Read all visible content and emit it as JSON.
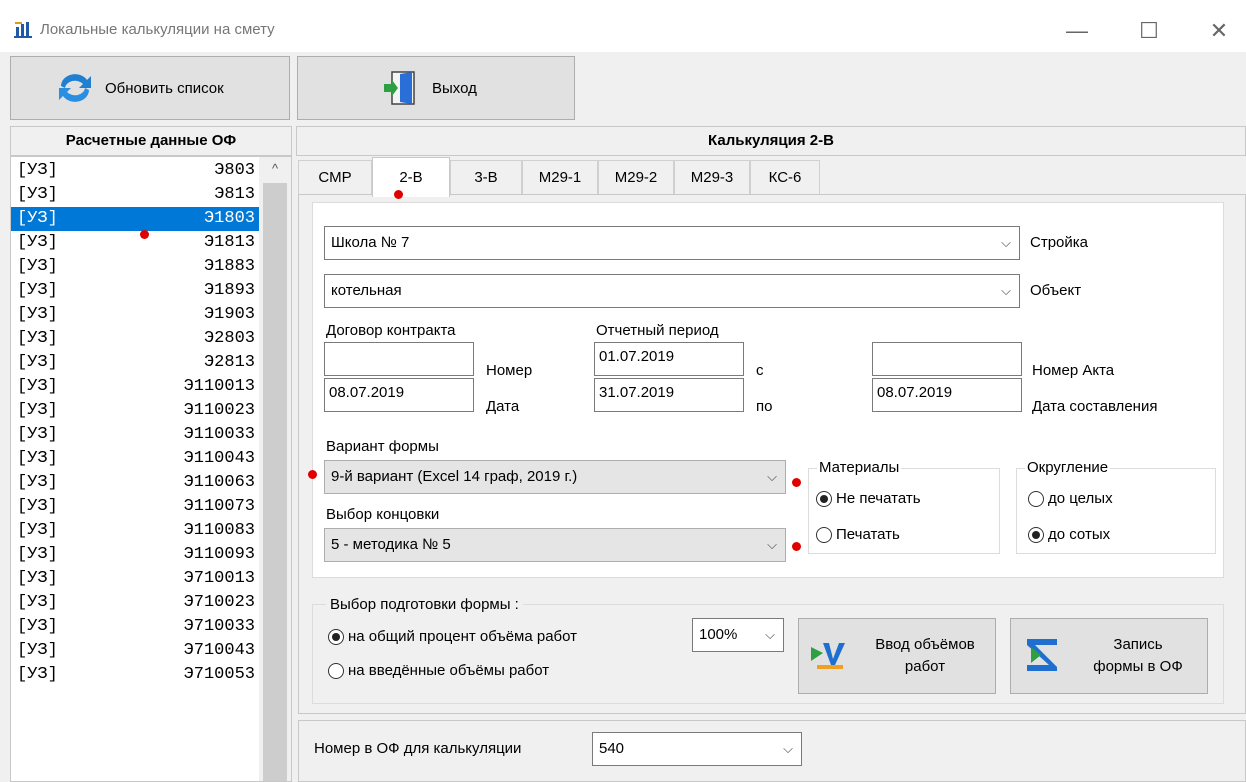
{
  "window": {
    "title": "Локальные калькуляции на смету",
    "min_glyph": "—",
    "max_glyph": "☐",
    "close_glyph": "✕"
  },
  "toolbar": {
    "refresh_label": "Обновить список",
    "exit_label": "Выход"
  },
  "left_panel": {
    "header": "Расчетные данные ОФ",
    "rows": [
      {
        "left": "[УЗ]",
        "right": "Э803"
      },
      {
        "left": "[УЗ]",
        "right": "Э813"
      },
      {
        "left": "[УЗ]",
        "right": "Э1803"
      },
      {
        "left": "[УЗ]",
        "right": "Э1813"
      },
      {
        "left": "[УЗ]",
        "right": "Э1883"
      },
      {
        "left": "[УЗ]",
        "right": "Э1893"
      },
      {
        "left": "[УЗ]",
        "right": "Э1903"
      },
      {
        "left": "[УЗ]",
        "right": "Э2803"
      },
      {
        "left": "[УЗ]",
        "right": "Э2813"
      },
      {
        "left": "[УЗ]",
        "right": "Э110013"
      },
      {
        "left": "[УЗ]",
        "right": "Э110023"
      },
      {
        "left": "[УЗ]",
        "right": "Э110033"
      },
      {
        "left": "[УЗ]",
        "right": "Э110043"
      },
      {
        "left": "[УЗ]",
        "right": "Э110063"
      },
      {
        "left": "[УЗ]",
        "right": "Э110073"
      },
      {
        "left": "[УЗ]",
        "right": "Э110083"
      },
      {
        "left": "[УЗ]",
        "right": "Э110093"
      },
      {
        "left": "[УЗ]",
        "right": "Э710013"
      },
      {
        "left": "[УЗ]",
        "right": "Э710023"
      },
      {
        "left": "[УЗ]",
        "right": "Э710033"
      },
      {
        "left": "[УЗ]",
        "right": "Э710043"
      },
      {
        "left": "[УЗ]",
        "right": "Э710053"
      }
    ],
    "selected_index": 2,
    "scroll_up_glyph": "^"
  },
  "right_panel": {
    "header": "Калькуляция 2-В",
    "tabs": [
      {
        "label": "СМР"
      },
      {
        "label": "2-В"
      },
      {
        "label": "3-В"
      },
      {
        "label": "М29-1"
      },
      {
        "label": "М29-2"
      },
      {
        "label": "М29-3"
      },
      {
        "label": "КС-6"
      }
    ],
    "active_tab": 1
  },
  "form": {
    "construction": {
      "value": "Школа № 7",
      "label": "Стройка"
    },
    "object": {
      "value": "котельная",
      "label": "Объект"
    },
    "contract": {
      "title": "Договор контракта",
      "number_value": "",
      "number_label": "Номер",
      "date_value": "08.07.2019",
      "date_label": "Дата"
    },
    "period": {
      "title": "Отчетный период",
      "from_value": "01.07.2019",
      "from_label": "с",
      "to_value": "31.07.2019",
      "to_label": "по"
    },
    "act": {
      "number_value": "",
      "number_label": "Номер Акта",
      "date_value": "08.07.2019",
      "date_label": "Дата составления"
    },
    "form_variant": {
      "label": "Вариант формы",
      "value": "9-й вариант (Excel 14 граф, 2019 г.)"
    },
    "ending": {
      "label": "Выбор концовки",
      "value": "5 - методика № 5"
    },
    "materials": {
      "title": "Материалы",
      "options": [
        "Не печатать",
        "Печатать"
      ],
      "selected": 0
    },
    "rounding": {
      "title": "Округление",
      "options": [
        "до целых",
        "до сотых"
      ],
      "selected": 1
    },
    "preparation": {
      "title": "Выбор подготовки формы :",
      "options": [
        "на общий процент объёма работ",
        "на введённые объёмы работ"
      ],
      "selected": 0,
      "percent": "100%"
    },
    "input_volumes_label_1": "Ввод объёмов",
    "input_volumes_label_2": "работ",
    "write_form_label_1": "Запись",
    "write_form_label_2": "формы в ОФ"
  },
  "bottom": {
    "label": "Номер в ОФ для калькуляции",
    "value": "540"
  },
  "arrow_glyph": "⌵",
  "colors": {
    "selection": "#0078d7",
    "marker": "#e00000"
  }
}
